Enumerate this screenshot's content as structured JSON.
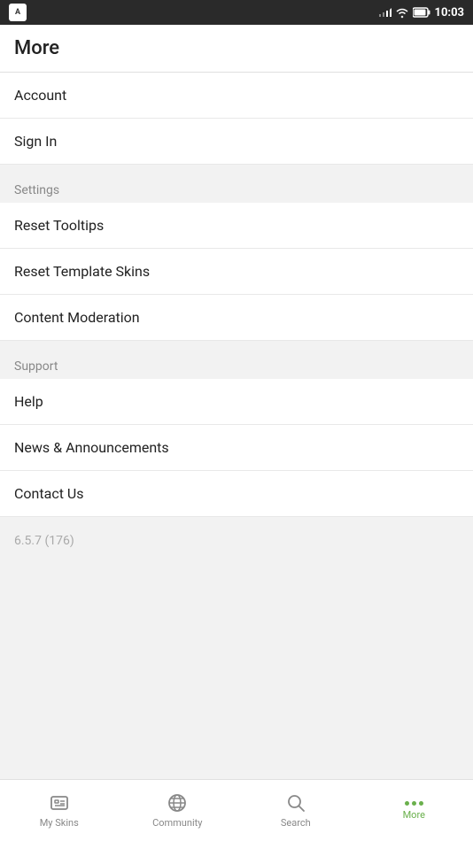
{
  "statusBar": {
    "time": "10:03"
  },
  "pageTitle": "More",
  "sections": [
    {
      "items": [
        {
          "id": "account",
          "label": "Account"
        },
        {
          "id": "sign-in",
          "label": "Sign In"
        }
      ]
    },
    {
      "header": "Settings",
      "items": [
        {
          "id": "reset-tooltips",
          "label": "Reset Tooltips"
        },
        {
          "id": "reset-template-skins",
          "label": "Reset Template Skins"
        },
        {
          "id": "content-moderation",
          "label": "Content Moderation"
        }
      ]
    },
    {
      "header": "Support",
      "items": [
        {
          "id": "help",
          "label": "Help"
        },
        {
          "id": "news-announcements",
          "label": "News & Announcements"
        },
        {
          "id": "contact-us",
          "label": "Contact Us"
        }
      ]
    }
  ],
  "version": "6.5.7 (176)",
  "bottomNav": {
    "items": [
      {
        "id": "my-skins",
        "label": "My Skins",
        "icon": "skins"
      },
      {
        "id": "community",
        "label": "Community",
        "icon": "community"
      },
      {
        "id": "search",
        "label": "Search",
        "icon": "search"
      },
      {
        "id": "more",
        "label": "More",
        "icon": "more",
        "active": true
      }
    ]
  }
}
